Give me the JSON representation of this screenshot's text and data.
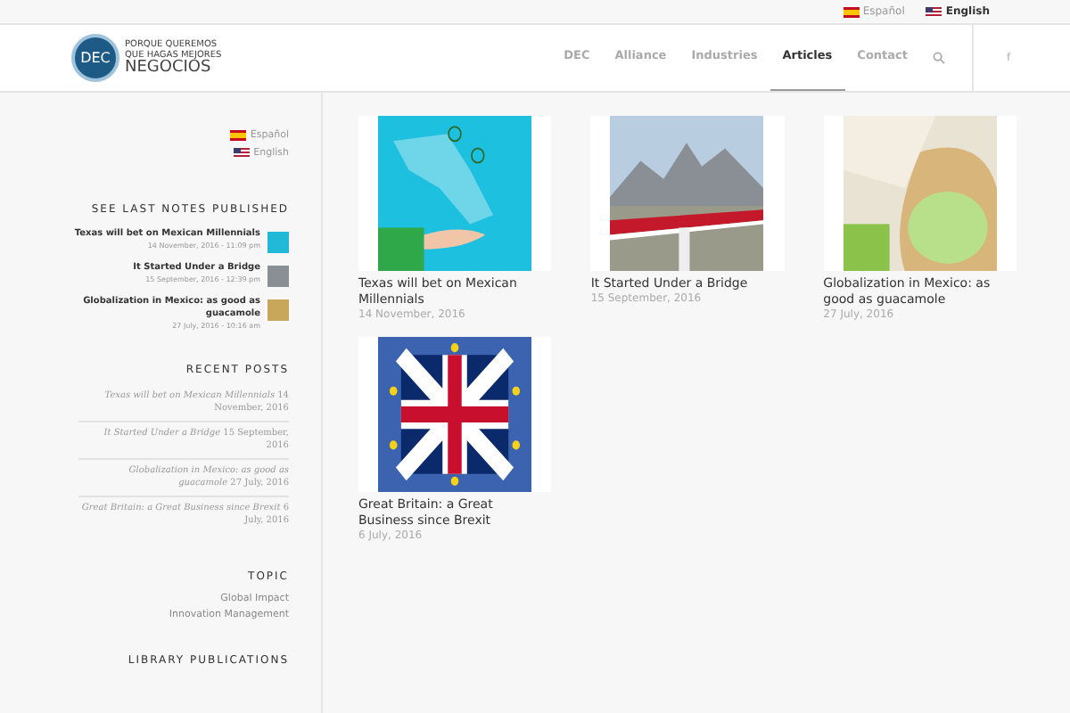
{
  "top_bar": {
    "languages": [
      {
        "label": "Español",
        "selected": false
      },
      {
        "label": "English",
        "selected": true
      }
    ]
  },
  "header": {
    "logo": {
      "mark": "DEC",
      "tagline": [
        "PORQUE QUEREMOS",
        "QUE HAGAS MEJORES",
        "NEGOCIOS"
      ]
    },
    "nav": [
      {
        "label": "DEC",
        "selected": false
      },
      {
        "label": "Alliance",
        "selected": false
      },
      {
        "label": "Industries",
        "selected": false
      },
      {
        "label": "Articles",
        "selected": true
      },
      {
        "label": "Contact",
        "selected": false
      }
    ],
    "social": "f"
  },
  "sidebar": {
    "languages": [
      {
        "label": "Español"
      },
      {
        "label": "English"
      }
    ],
    "last_notes": {
      "title": "SEE LAST NOTES PUBLISHED",
      "items": [
        {
          "title": "Texas will bet on Mexican Millennials",
          "date": "14 November, 2016 - 11:09 pm"
        },
        {
          "title": "It Started Under a Bridge",
          "date": "15 September, 2016 - 12:39 pm"
        },
        {
          "title": "Globalization in Mexico: as good as guacamole",
          "date": "27 July, 2016 - 10:16 am"
        }
      ]
    },
    "recent_posts": {
      "title": "RECENT POSTS",
      "items": [
        {
          "title": "Texas will bet on Mexican Millennials",
          "date": "14 November, 2016"
        },
        {
          "title": "It Started Under a Bridge",
          "date": "15 September, 2016"
        },
        {
          "title": "Globalization in Mexico: as good as guacamole",
          "date": "27 July, 2016"
        },
        {
          "title": "Great Britain: a Great Business since Brexit",
          "date": "6 July, 2016"
        }
      ]
    },
    "topic": {
      "title": "TOPIC",
      "items": [
        "Global Impact",
        "Innovation Management"
      ]
    },
    "library": {
      "title": "LIBRARY PUBLICATIONS"
    }
  },
  "articles": [
    {
      "title": "Texas will bet on Mexican Millennials",
      "date": "14 November, 2016"
    },
    {
      "title": "It Started Under a Bridge",
      "date": "15 September, 2016"
    },
    {
      "title": "Globalization in Mexico: as good as guacamole",
      "date": "27 July, 2016"
    },
    {
      "title": "Great Britain: a Great Business since Brexit",
      "date": "6 July, 2016"
    }
  ]
}
